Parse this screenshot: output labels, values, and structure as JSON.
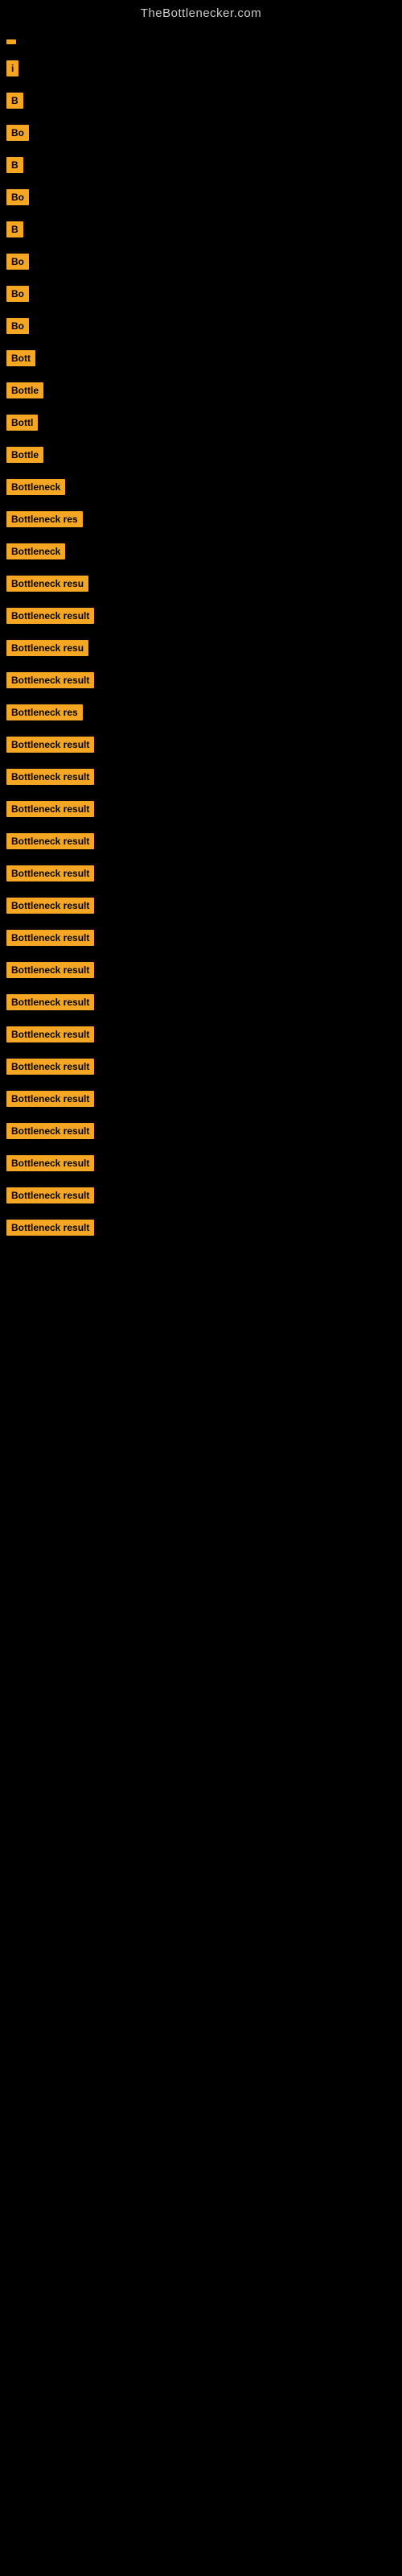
{
  "site": {
    "title": "TheBottlenecker.com"
  },
  "items": [
    {
      "id": 1,
      "label": ""
    },
    {
      "id": 2,
      "label": "i"
    },
    {
      "id": 3,
      "label": "B"
    },
    {
      "id": 4,
      "label": "Bo"
    },
    {
      "id": 5,
      "label": "B"
    },
    {
      "id": 6,
      "label": "Bo"
    },
    {
      "id": 7,
      "label": "B"
    },
    {
      "id": 8,
      "label": "Bo"
    },
    {
      "id": 9,
      "label": "Bo"
    },
    {
      "id": 10,
      "label": "Bo"
    },
    {
      "id": 11,
      "label": "Bott"
    },
    {
      "id": 12,
      "label": "Bottle"
    },
    {
      "id": 13,
      "label": "Bottl"
    },
    {
      "id": 14,
      "label": "Bottle"
    },
    {
      "id": 15,
      "label": "Bottleneck"
    },
    {
      "id": 16,
      "label": "Bottleneck res"
    },
    {
      "id": 17,
      "label": "Bottleneck"
    },
    {
      "id": 18,
      "label": "Bottleneck resu"
    },
    {
      "id": 19,
      "label": "Bottleneck result"
    },
    {
      "id": 20,
      "label": "Bottleneck resu"
    },
    {
      "id": 21,
      "label": "Bottleneck result"
    },
    {
      "id": 22,
      "label": "Bottleneck res"
    },
    {
      "id": 23,
      "label": "Bottleneck result"
    },
    {
      "id": 24,
      "label": "Bottleneck result"
    },
    {
      "id": 25,
      "label": "Bottleneck result"
    },
    {
      "id": 26,
      "label": "Bottleneck result"
    },
    {
      "id": 27,
      "label": "Bottleneck result"
    },
    {
      "id": 28,
      "label": "Bottleneck result"
    },
    {
      "id": 29,
      "label": "Bottleneck result"
    },
    {
      "id": 30,
      "label": "Bottleneck result"
    },
    {
      "id": 31,
      "label": "Bottleneck result"
    },
    {
      "id": 32,
      "label": "Bottleneck result"
    },
    {
      "id": 33,
      "label": "Bottleneck result"
    },
    {
      "id": 34,
      "label": "Bottleneck result"
    },
    {
      "id": 35,
      "label": "Bottleneck result"
    },
    {
      "id": 36,
      "label": "Bottleneck result"
    },
    {
      "id": 37,
      "label": "Bottleneck result"
    },
    {
      "id": 38,
      "label": "Bottleneck result"
    }
  ]
}
